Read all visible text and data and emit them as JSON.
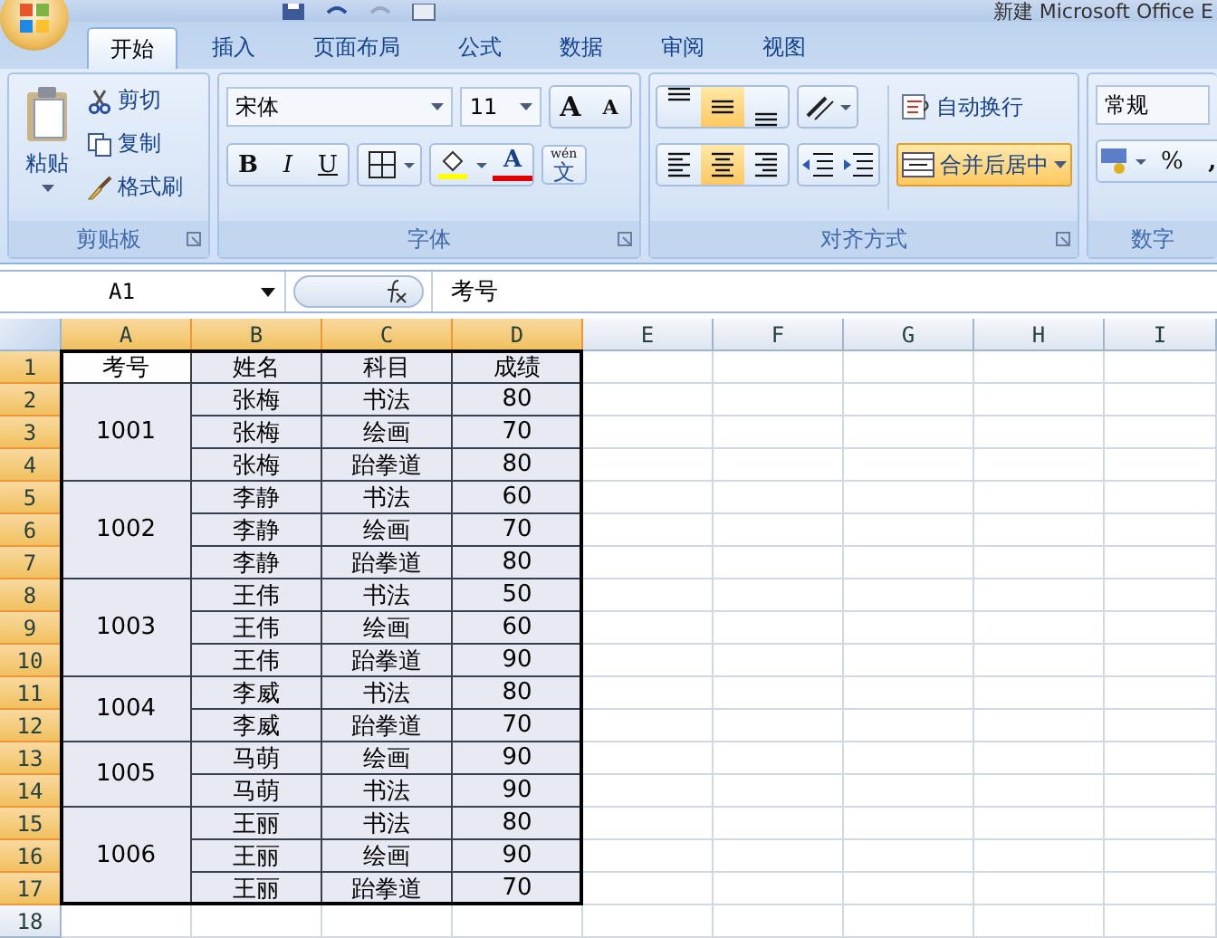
{
  "title": "新建 Microsoft Office E",
  "tabs": [
    {
      "label": "开始",
      "selected": true
    },
    {
      "label": "插入",
      "selected": false
    },
    {
      "label": "页面布局",
      "selected": false
    },
    {
      "label": "公式",
      "selected": false
    },
    {
      "label": "数据",
      "selected": false
    },
    {
      "label": "审阅",
      "selected": false
    },
    {
      "label": "视图",
      "selected": false
    }
  ],
  "clipboard": {
    "label": "剪贴板",
    "paste": "粘贴",
    "actions": [
      {
        "kind": "cut",
        "label": "剪切"
      },
      {
        "kind": "copy",
        "label": "复制"
      },
      {
        "kind": "painter",
        "label": "格式刷"
      }
    ]
  },
  "font": {
    "label": "字体",
    "font_name": "宋体",
    "font_size": "11",
    "grow": "A",
    "shrink": "A",
    "bold": "B",
    "italic": "I",
    "underline": "U",
    "font_color": "A",
    "phonetic": "文",
    "phonetic_hint": "wén"
  },
  "alignment": {
    "label": "对齐方式",
    "vertical": [
      {
        "kind": "top",
        "selected": false
      },
      {
        "kind": "middle",
        "selected": true
      },
      {
        "kind": "bottom",
        "selected": false
      }
    ],
    "horizontal": [
      {
        "kind": "left",
        "selected": false
      },
      {
        "kind": "center",
        "selected": true
      },
      {
        "kind": "right",
        "selected": false
      }
    ],
    "wrap_text": "自动换行",
    "merge": {
      "label": "合并后居中",
      "selected": true
    }
  },
  "number": {
    "label": "数字",
    "format": "常规",
    "percent": "%",
    "comma": ","
  },
  "formula_bar": {
    "name_box": "A1",
    "content": "考号"
  },
  "sheet": {
    "columns": [
      {
        "label": "A",
        "selected": true
      },
      {
        "label": "B",
        "selected": true
      },
      {
        "label": "C",
        "selected": true
      },
      {
        "label": "D",
        "selected": true
      },
      {
        "label": "E",
        "selected": false
      },
      {
        "label": "F",
        "selected": false
      },
      {
        "label": "G",
        "selected": false
      },
      {
        "label": "H",
        "selected": false
      },
      {
        "label": "I",
        "selected": false
      }
    ],
    "rows": [
      {
        "label": "1",
        "selected": true
      },
      {
        "label": "2",
        "selected": true
      },
      {
        "label": "3",
        "selected": true
      },
      {
        "label": "4",
        "selected": true
      },
      {
        "label": "5",
        "selected": true
      },
      {
        "label": "6",
        "selected": true
      },
      {
        "label": "7",
        "selected": true
      },
      {
        "label": "8",
        "selected": true
      },
      {
        "label": "9",
        "selected": true
      },
      {
        "label": "10",
        "selected": true
      },
      {
        "label": "11",
        "selected": true
      },
      {
        "label": "12",
        "selected": true
      },
      {
        "label": "13",
        "selected": true
      },
      {
        "label": "14",
        "selected": true
      },
      {
        "label": "15",
        "selected": true
      },
      {
        "label": "16",
        "selected": true
      },
      {
        "label": "17",
        "selected": true
      },
      {
        "label": "18",
        "selected": false
      }
    ],
    "header": [
      {
        "text": "考号",
        "active": true
      },
      {
        "text": "姓名",
        "active": false
      },
      {
        "text": "科目",
        "active": false
      },
      {
        "text": "成绩",
        "active": false
      }
    ],
    "groups": [
      {
        "id": "1001",
        "records": [
          {
            "name": "张梅",
            "subject": "书法",
            "score": "80"
          },
          {
            "name": "张梅",
            "subject": "绘画",
            "score": "70"
          },
          {
            "name": "张梅",
            "subject": "跆拳道",
            "score": "80"
          }
        ]
      },
      {
        "id": "1002",
        "records": [
          {
            "name": "李静",
            "subject": "书法",
            "score": "60"
          },
          {
            "name": "李静",
            "subject": "绘画",
            "score": "70"
          },
          {
            "name": "李静",
            "subject": "跆拳道",
            "score": "80"
          }
        ]
      },
      {
        "id": "1003",
        "records": [
          {
            "name": "王伟",
            "subject": "书法",
            "score": "50"
          },
          {
            "name": "王伟",
            "subject": "绘画",
            "score": "60"
          },
          {
            "name": "王伟",
            "subject": "跆拳道",
            "score": "90"
          }
        ]
      },
      {
        "id": "1004",
        "records": [
          {
            "name": "李威",
            "subject": "书法",
            "score": "80"
          },
          {
            "name": "李威",
            "subject": "跆拳道",
            "score": "70"
          }
        ]
      },
      {
        "id": "1005",
        "records": [
          {
            "name": "马萌",
            "subject": "绘画",
            "score": "90"
          },
          {
            "name": "马萌",
            "subject": "书法",
            "score": "90"
          }
        ]
      },
      {
        "id": "1006",
        "records": [
          {
            "name": "王丽",
            "subject": "书法",
            "score": "80"
          },
          {
            "name": "王丽",
            "subject": "绘画",
            "score": "90"
          },
          {
            "name": "王丽",
            "subject": "跆拳道",
            "score": "70"
          }
        ]
      }
    ]
  }
}
